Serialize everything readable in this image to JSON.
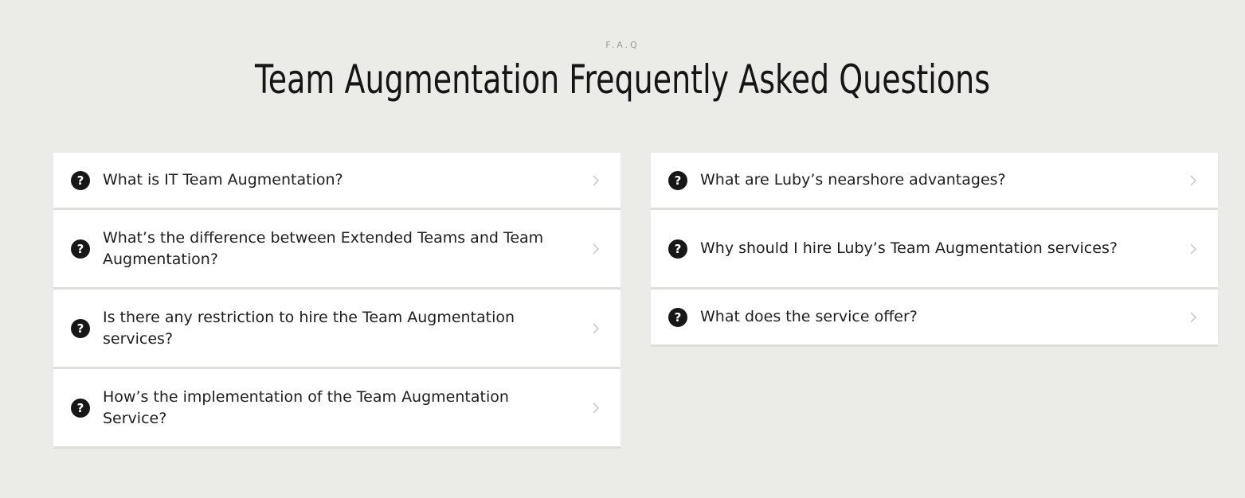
{
  "header": {
    "eyebrow": "F.A.Q",
    "title": "Team Augmentation Frequently Asked Questions"
  },
  "faq_left": [
    {
      "question": "What is IT Team Augmentation?",
      "icon": "question-circle-icon"
    },
    {
      "question": "What’s the difference between Extended Teams and Team Augmentation?",
      "icon": "question-circle-icon"
    },
    {
      "question": "Is there any restriction to hire the Team Augmentation services?",
      "icon": "question-circle-icon"
    },
    {
      "question": "How’s the implementation of the Team Augmentation Service?",
      "icon": "question-circle-icon"
    }
  ],
  "faq_right": [
    {
      "question": "What are Luby’s nearshore advantages?",
      "icon": "question-circle-icon"
    },
    {
      "question": "Why should I hire Luby’s Team Augmentation services?",
      "icon": "question-circle-icon"
    },
    {
      "question": "What does the service offer?",
      "icon": "question-circle-icon"
    }
  ],
  "icons": {
    "question": "?",
    "expand": "chevron-right-icon"
  },
  "colors": {
    "background": "#ebebe7",
    "card": "#ffffff",
    "divider": "#dededa",
    "icon_fill": "#171717",
    "chevron": "#c4c4c0"
  }
}
